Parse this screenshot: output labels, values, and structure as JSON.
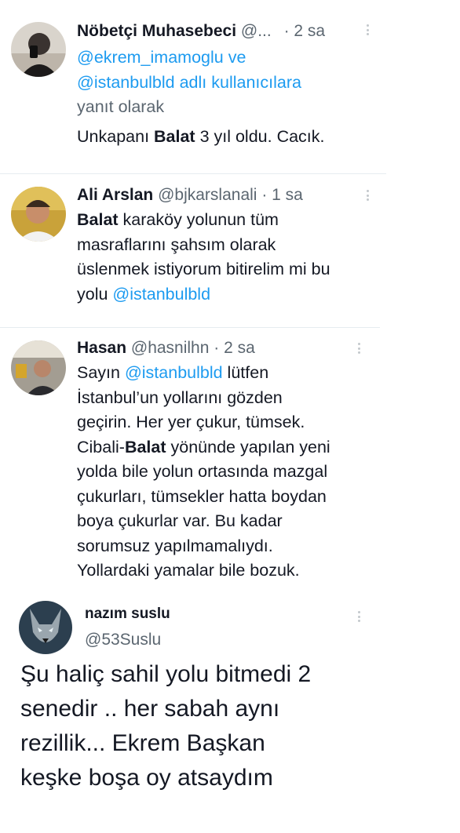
{
  "tweets": [
    {
      "name": "Nöbetçi Muhasebeci",
      "handle": "@...",
      "sep": "·",
      "time": "2 sa",
      "reply_line1": "@ekrem_imamoglu ve",
      "reply_line2_link": "@istanbulbld",
      "reply_line2_rest": " adlı kullanıcılara",
      "reply_line3": "yanıt olarak",
      "body_pre": "Unkapanı ",
      "body_bold": "Balat",
      "body_post": " 3 yıl oldu. Cacık."
    },
    {
      "name": "Ali Arslan",
      "handle": "@bjkarslanali",
      "sep": "·",
      "time": "1 sa",
      "l1_bold": "Balat",
      "l1_rest": " karaköy yolunun tüm",
      "l2": "masraflarını şahsım olarak",
      "l3": "üslenmek istiyorum bitirelim mi bu",
      "l4_pre": "yolu ",
      "l4_link": "@istanbulbld"
    },
    {
      "name": "Hasan",
      "handle": "@hasnilhn",
      "sep": "·",
      "time": "2 sa",
      "l1_pre": "Sayın ",
      "l1_link": "@istanbulbld",
      "l1_post": " lütfen",
      "l2": "İstanbul’un yollarını gözden",
      "l3": "geçirin. Her yer çukur, tümsek.",
      "l4_pre": "Cibali-",
      "l4_bold": "Balat",
      "l4_post": " yönünde yapılan yeni",
      "l5": "yolda bile yolun ortasında mazgal",
      "l6": "çukurları, tümsekler hatta boydan",
      "l7": "boya çukurlar var. Bu kadar",
      "l8": "sorumsuz yapılmamalıydı.",
      "l9": "Yollardaki yamalar bile bozuk."
    },
    {
      "name": "nazım suslu",
      "handle": "@53Suslu",
      "l1": "Şu haliç sahil yolu bitmedi 2",
      "l2": "senedir .. her sabah aynı",
      "l3": "rezillik... Ekrem Başkan",
      "l4": "keşke boşa oy atsaydım"
    }
  ],
  "colors": {
    "link": "#1d9bf0",
    "text": "#141823",
    "muted": "#5b6670",
    "divider": "#e6ecf0"
  }
}
